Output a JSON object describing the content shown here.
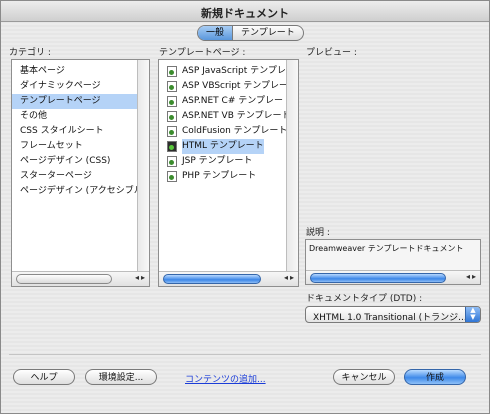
{
  "window": {
    "title": "新規ドキュメント"
  },
  "tabs": [
    {
      "label": "一般",
      "active": true
    },
    {
      "label": "テンプレート",
      "active": false
    }
  ],
  "category": {
    "label": "カテゴリ :",
    "items": [
      {
        "label": "基本ページ",
        "selected": false
      },
      {
        "label": "ダイナミックページ",
        "selected": false
      },
      {
        "label": "テンプレートページ",
        "selected": true
      },
      {
        "label": "その他",
        "selected": false
      },
      {
        "label": "CSS スタイルシート",
        "selected": false
      },
      {
        "label": "フレームセット",
        "selected": false
      },
      {
        "label": "ページデザイン (CSS)",
        "selected": false
      },
      {
        "label": "スターターページ",
        "selected": false
      },
      {
        "label": "ページデザイン (アクセシブル)",
        "selected": false
      }
    ]
  },
  "template_pages": {
    "label": "テンプレートページ :",
    "items": [
      {
        "label": "ASP JavaScript テンプレ-",
        "icon": "document-icon",
        "selected": false
      },
      {
        "label": "ASP VBScript テンプレー",
        "icon": "document-icon",
        "selected": false
      },
      {
        "label": "ASP.NET C# テンプレート",
        "icon": "document-icon",
        "selected": false
      },
      {
        "label": "ASP.NET VB テンプレート",
        "icon": "document-icon",
        "selected": false
      },
      {
        "label": "ColdFusion テンプレート",
        "icon": "document-icon",
        "selected": false
      },
      {
        "label": "HTML テンプレート",
        "icon": "html-document-icon",
        "selected": true
      },
      {
        "label": "JSP テンプレート",
        "icon": "document-icon",
        "selected": false
      },
      {
        "label": "PHP テンプレート",
        "icon": "document-icon",
        "selected": false
      }
    ]
  },
  "preview": {
    "label": "プレビュー :"
  },
  "description": {
    "label": "説明 :",
    "text": "Dreamweaver テンプレートドキュメント"
  },
  "doctype": {
    "label": "ドキュメントタイプ (DTD) :",
    "value": "XHTML 1.0 Transitional (トランジ..."
  },
  "buttons": {
    "help": "ヘルプ",
    "preferences": "環境設定...",
    "more_content": "コンテンツの追加...",
    "cancel": "キャンセル",
    "create": "作成"
  },
  "colors": {
    "selection": "#b5d3f7",
    "accent": "#3f8ae9",
    "link": "#1a3cd8"
  }
}
